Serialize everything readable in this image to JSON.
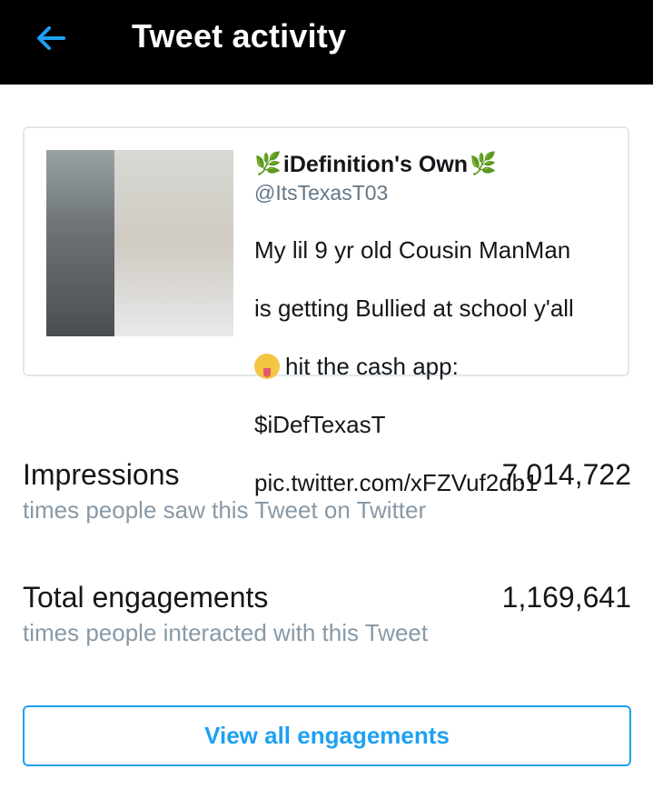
{
  "header": {
    "title": "Tweet activity"
  },
  "icons": {
    "back": "arrow-left-icon",
    "leaf": "herb-emoji",
    "face": "drooling-face-emoji"
  },
  "colors": {
    "accent": "#1da1f2",
    "header_bg": "#000000",
    "muted": "#8899a6"
  },
  "tweet": {
    "display_name": "iDefinition's Own",
    "handle": "@ItsTexasT03",
    "text_line1": "My lil 9 yr old Cousin ManMan",
    "text_line2": "is getting Bullied at school y'all",
    "text_line3": "hit the cash app:",
    "text_line4": "$iDefTexasT",
    "text_line5": "pic.twitter.com/xFZVuf2db1"
  },
  "stats": [
    {
      "label": "Impressions",
      "value": "7,014,722",
      "sub": "times people saw this Tweet on Twitter"
    },
    {
      "label": "Total engagements",
      "value": "1,169,641",
      "sub": "times people interacted with this Tweet"
    }
  ],
  "cta": {
    "label": "View all engagements"
  }
}
